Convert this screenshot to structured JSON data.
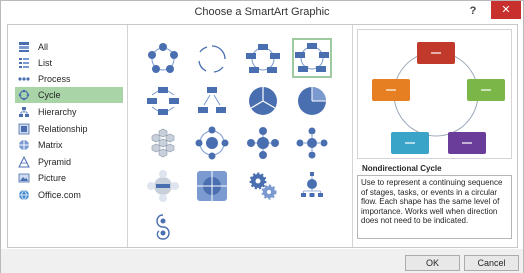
{
  "dialog": {
    "title": "Choose a SmartArt Graphic",
    "help_label": "?",
    "close_label": "✕"
  },
  "sidebar": {
    "items": [
      {
        "label": "All",
        "icon": "all-icon"
      },
      {
        "label": "List",
        "icon": "list-icon"
      },
      {
        "label": "Process",
        "icon": "process-icon"
      },
      {
        "label": "Cycle",
        "icon": "cycle-icon",
        "selected": true
      },
      {
        "label": "Hierarchy",
        "icon": "hierarchy-icon"
      },
      {
        "label": "Relationship",
        "icon": "relationship-icon"
      },
      {
        "label": "Matrix",
        "icon": "matrix-icon"
      },
      {
        "label": "Pyramid",
        "icon": "pyramid-icon"
      },
      {
        "label": "Picture",
        "icon": "picture-icon"
      },
      {
        "label": "Office.com",
        "icon": "office-com-icon"
      }
    ]
  },
  "preview": {
    "title": "Nondirectional Cycle",
    "description": "Use to represent a continuing sequence of stages, tasks, or events in a circular flow. Each shape has the same level of importance. Works well when direction does not need to be indicated.",
    "shape_colors": [
      "#c0392b",
      "#7ab648",
      "#6a3d9a",
      "#3aa3c8",
      "#e67e22"
    ]
  },
  "buttons": {
    "ok": "OK",
    "cancel": "Cancel"
  },
  "colors": {
    "accent": "#a8d4a8",
    "thumb_blue": "#4a6fb0",
    "close_red": "#c7302c"
  }
}
